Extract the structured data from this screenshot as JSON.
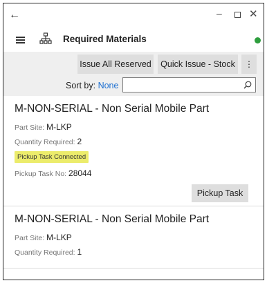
{
  "titlebar": {
    "back": "←",
    "minimize": "–",
    "close": "✕"
  },
  "header": {
    "title": "Required Materials",
    "status_color": "#2e9e3e"
  },
  "toolbar": {
    "issue_all_reserved": "Issue All Reserved",
    "quick_issue_stock": "Quick Issue - Stock",
    "more": "⋮"
  },
  "sort": {
    "label": "Sort by:",
    "value": "None"
  },
  "search": {
    "value": "",
    "placeholder": ""
  },
  "items": [
    {
      "title": "M-NON-SERIAL - Non Serial Mobile Part",
      "part_site_label": "Part Site:",
      "part_site": "M-LKP",
      "qty_label": "Quantity Required:",
      "qty": "2",
      "badge": "Pickup Task Connected",
      "pickup_no_label": "Pickup Task No:",
      "pickup_no": "28044",
      "action": "Pickup Task"
    },
    {
      "title": "M-NON-SERIAL - Non Serial Mobile Part",
      "part_site_label": "Part Site:",
      "part_site": "M-LKP",
      "qty_label": "Quantity Required:",
      "qty": "1"
    }
  ],
  "colors": {
    "accent": "#1c6fd1",
    "badge_bg": "#ecec6b",
    "toolbar_bg": "#efefef"
  }
}
